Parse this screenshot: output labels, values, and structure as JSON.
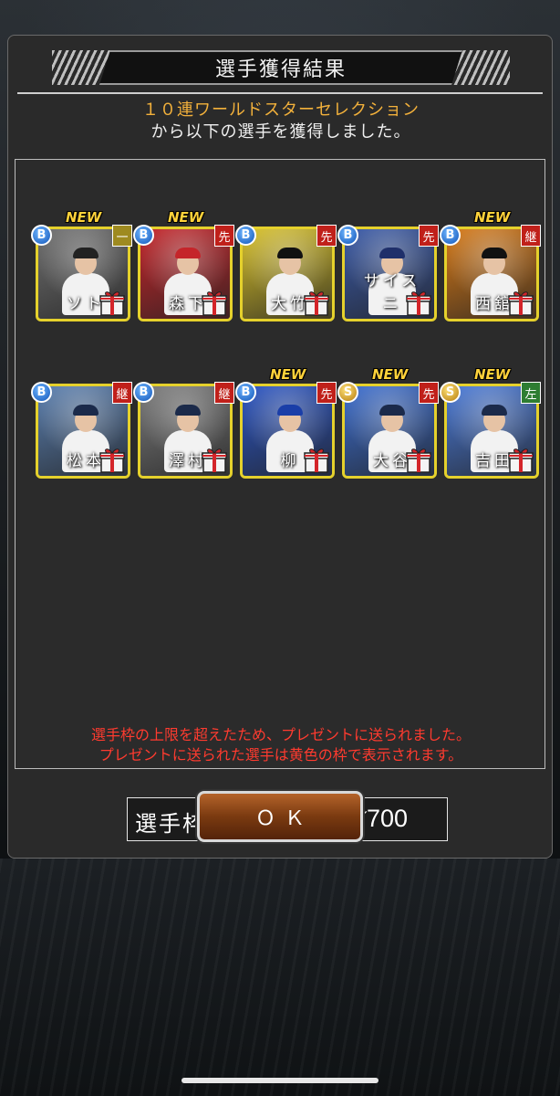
{
  "dialog": {
    "title": "選手獲得結果",
    "subtitle_line1": "１０連ワールドスターセレクション",
    "subtitle_line2": "から以下の選手を獲得しました。",
    "slot_label": "選手枠：",
    "slot_current": "700",
    "slot_separator": "／",
    "slot_max": "700",
    "warning_line1": "選手枠の上限を超えたため、プレゼントに送られました。",
    "warning_line2": "プレゼントに送られた選手は黄色の枠で表示されます。",
    "ok_label": "ＯＫ"
  },
  "new_tag": "NEW",
  "colors": {
    "card_border": "#e5d12c",
    "warning": "#ff3b2f",
    "subtitle_accent": "#f3b13b",
    "slot_current": "#e13b2e"
  },
  "players": [
    {
      "name": "ソト",
      "rank": "B",
      "position": "一",
      "position_color": "#9e8a20",
      "is_new": true,
      "art": "#6f6f6f",
      "cap": "#222"
    },
    {
      "name": "森下",
      "rank": "B",
      "position": "先",
      "position_color": "#c0201a",
      "is_new": true,
      "art": "#c5252a",
      "cap": "#c5252a"
    },
    {
      "name": "大竹",
      "rank": "B",
      "position": "先",
      "position_color": "#c0201a",
      "is_new": false,
      "art": "#d8c12a",
      "cap": "#111"
    },
    {
      "name": "サイスニ",
      "rank": "B",
      "position": "先",
      "position_color": "#c0201a",
      "is_new": false,
      "art": "#3a5aa8",
      "cap": "#1f2f6a"
    },
    {
      "name": "西舘",
      "rank": "B",
      "position": "継",
      "position_color": "#c0201a",
      "is_new": true,
      "art": "#d77a18",
      "cap": "#111"
    },
    {
      "name": "松本",
      "rank": "B",
      "position": "継",
      "position_color": "#c0201a",
      "is_new": false,
      "art": "#5a7fb0",
      "cap": "#1b2a4a"
    },
    {
      "name": "澤村",
      "rank": "B",
      "position": "継",
      "position_color": "#c0201a",
      "is_new": false,
      "art": "#7b7b7b",
      "cap": "#1b2a4a"
    },
    {
      "name": "柳",
      "rank": "B",
      "position": "先",
      "position_color": "#c0201a",
      "is_new": true,
      "art": "#2b55c4",
      "cap": "#1a3ea8"
    },
    {
      "name": "大谷",
      "rank": "S",
      "position": "先",
      "position_color": "#c0201a",
      "is_new": true,
      "art": "#3c6ed0",
      "cap": "#1b2a4a"
    },
    {
      "name": "吉田",
      "rank": "S",
      "position": "左",
      "position_color": "#2e7d32",
      "is_new": true,
      "art": "#4a7ad8",
      "cap": "#1b2a4a"
    }
  ]
}
